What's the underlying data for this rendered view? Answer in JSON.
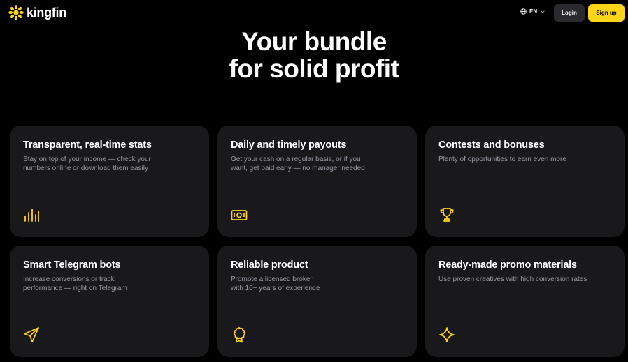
{
  "header": {
    "brand": "kingfin",
    "language": "EN",
    "login_label": "Login",
    "signup_label": "Sign up"
  },
  "hero": {
    "line1": "Your bundle",
    "line2": "for solid profit"
  },
  "cards": [
    {
      "title": "Transparent, real-time stats",
      "desc_line1": "Stay on top of your income — check your",
      "desc_line2": "numbers online or download them easily",
      "icon": "bar-chart-icon"
    },
    {
      "title": "Daily and timely payouts",
      "desc_line1": "Get your cash on a regular basis, or if you",
      "desc_line2": "want, get paid early — no manager needed",
      "icon": "cash-icon"
    },
    {
      "title": "Contests and bonuses",
      "desc_line1": "Plenty of opportunities to earn even more",
      "desc_line2": "",
      "icon": "trophy-icon"
    },
    {
      "title": "Smart Telegram bots",
      "desc_line1": "Increase conversions or track",
      "desc_line2": "performance — right on Telegram",
      "icon": "paper-plane-icon"
    },
    {
      "title": "Reliable product",
      "desc_line1": "Promote a licensed broker",
      "desc_line2": "with 10+ years of experience",
      "icon": "award-badge-icon"
    },
    {
      "title": "Ready-made promo materials",
      "desc_line1": "Use proven creatives with high conversion rates",
      "desc_line2": "",
      "icon": "sparkle-icon"
    }
  ],
  "colors": {
    "accent": "#ffd51a",
    "background": "#000000",
    "card": "#19191c",
    "muted_text": "#9b9ba3",
    "login_bg": "#2a2a2e"
  }
}
